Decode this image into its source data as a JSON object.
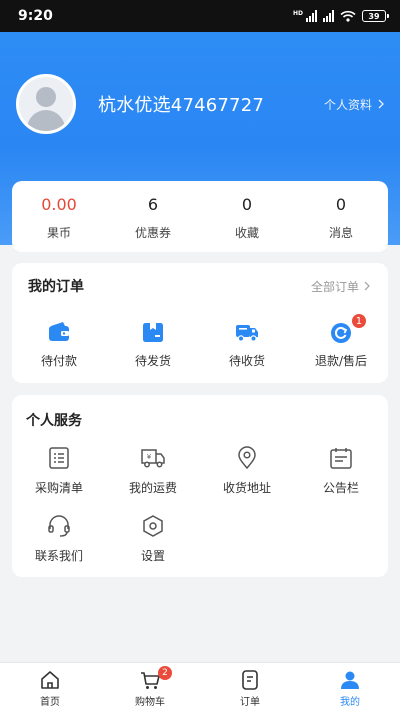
{
  "status_bar": {
    "time": "9:20",
    "network": "HD",
    "battery": "39"
  },
  "profile": {
    "username": "杭水优选47467727",
    "profile_link": "个人资料"
  },
  "stats": [
    {
      "value": "0.00",
      "label": "果币"
    },
    {
      "value": "6",
      "label": "优惠券"
    },
    {
      "value": "0",
      "label": "收藏"
    },
    {
      "value": "0",
      "label": "消息"
    }
  ],
  "orders": {
    "title": "我的订单",
    "all_link": "全部订单",
    "items": [
      {
        "label": "待付款",
        "icon": "wallet-icon"
      },
      {
        "label": "待发货",
        "icon": "package-icon"
      },
      {
        "label": "待收货",
        "icon": "truck-icon"
      },
      {
        "label": "退款/售后",
        "icon": "refund-icon",
        "badge": "1"
      }
    ]
  },
  "services": {
    "title": "个人服务",
    "items": [
      {
        "label": "采购清单",
        "icon": "list-icon"
      },
      {
        "label": "我的运费",
        "icon": "freight-truck-icon"
      },
      {
        "label": "收货地址",
        "icon": "location-pin-icon"
      },
      {
        "label": "公告栏",
        "icon": "calendar-notice-icon"
      },
      {
        "label": "联系我们",
        "icon": "headset-icon"
      },
      {
        "label": "设置",
        "icon": "settings-hexagon-icon"
      }
    ]
  },
  "tabbar": {
    "items": [
      {
        "label": "首页",
        "icon": "home-icon"
      },
      {
        "label": "购物车",
        "icon": "cart-icon",
        "badge": "2"
      },
      {
        "label": "订单",
        "icon": "order-icon"
      },
      {
        "label": "我的",
        "icon": "user-icon",
        "active": true
      }
    ]
  },
  "colors": {
    "primary": "#2b89f4",
    "accent_red": "#e4493a"
  }
}
